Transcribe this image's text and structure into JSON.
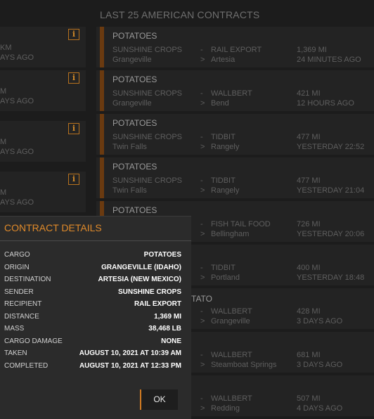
{
  "page_title": "LAST 25 AMERICAN CONTRACTS",
  "left_cards": [
    {
      "l1": "KM",
      "l2": "AYS AGO"
    },
    {
      "l1": "M",
      "l2": "AYS AGO"
    },
    {
      "l1": "M",
      "l2": "AYS AGO"
    },
    {
      "l1": "M",
      "l2": "AYS AGO"
    }
  ],
  "contracts": [
    {
      "cargo": "POTATOES",
      "sender": "SUNSHINE CROPS",
      "origin": "Grangeville",
      "recipient": "RAIL EXPORT",
      "destination": "Artesia",
      "distance": "1,369 MI",
      "time": "24 MINUTES AGO"
    },
    {
      "cargo": "POTATOES",
      "sender": "SUNSHINE CROPS",
      "origin": "Grangeville",
      "recipient": "WALLBERT",
      "destination": "Bend",
      "distance": "421 MI",
      "time": "12 HOURS AGO"
    },
    {
      "cargo": "POTATOES",
      "sender": "SUNSHINE CROPS",
      "origin": "Twin Falls",
      "recipient": "TIDBIT",
      "destination": "Rangely",
      "distance": "477 MI",
      "time": "YESTERDAY 22:52"
    },
    {
      "cargo": "POTATOES",
      "sender": "SUNSHINE CROPS",
      "origin": "Twin Falls",
      "recipient": "TIDBIT",
      "destination": "Rangely",
      "distance": "477 MI",
      "time": "YESTERDAY 21:04"
    },
    {
      "cargo": "POTATOES",
      "sender": "",
      "origin": "",
      "recipient": "FISH TAIL FOOD",
      "destination": "Bellingham",
      "distance": "726 MI",
      "time": "YESTERDAY 20:06"
    },
    {
      "cargo": "",
      "sender": "",
      "origin": "",
      "recipient": "TIDBIT",
      "destination": "Portland",
      "distance": "400 MI",
      "time": "YESTERDAY 18:48"
    },
    {
      "cargo": "TATO",
      "sender": "",
      "origin": "",
      "recipient": "WALLBERT",
      "destination": "Grangeville",
      "distance": "428 MI",
      "time": "3 DAYS AGO"
    },
    {
      "cargo": "",
      "sender": "",
      "origin": "",
      "recipient": "WALLBERT",
      "destination": "Steamboat Springs",
      "distance": "681 MI",
      "time": "3 DAYS AGO"
    },
    {
      "cargo": "",
      "sender": "",
      "origin": "",
      "recipient": "WALLBERT",
      "destination": "Redding",
      "distance": "507 MI",
      "time": "4 DAYS AGO"
    }
  ],
  "dialog": {
    "title": "CONTRACT DETAILS",
    "fields": [
      {
        "label": "CARGO",
        "value": "POTATOES"
      },
      {
        "label": "ORIGIN",
        "value": "GRANGEVILLE (IDAHO)"
      },
      {
        "label": "DESTINATION",
        "value": "ARTESIA (NEW MEXICO)"
      },
      {
        "label": "SENDER",
        "value": "SUNSHINE CROPS"
      },
      {
        "label": "RECIPIENT",
        "value": "RAIL EXPORT"
      },
      {
        "label": "DISTANCE",
        "value": "1,369 MI"
      },
      {
        "label": "MASS",
        "value": "38,468 LB"
      },
      {
        "label": "CARGO DAMAGE",
        "value": "NONE"
      },
      {
        "label": "TAKEN",
        "value": "AUGUST 10, 2021 AT 10:39 AM"
      },
      {
        "label": "COMPLETED",
        "value": "AUGUST 10, 2021 AT 12:33 PM"
      }
    ],
    "ok_label": "OK"
  },
  "colors": {
    "accent": "#e08a2a",
    "row_accent": "#6a3a10",
    "background": "#1c1c1c"
  },
  "icons": {
    "info": "info-icon"
  }
}
